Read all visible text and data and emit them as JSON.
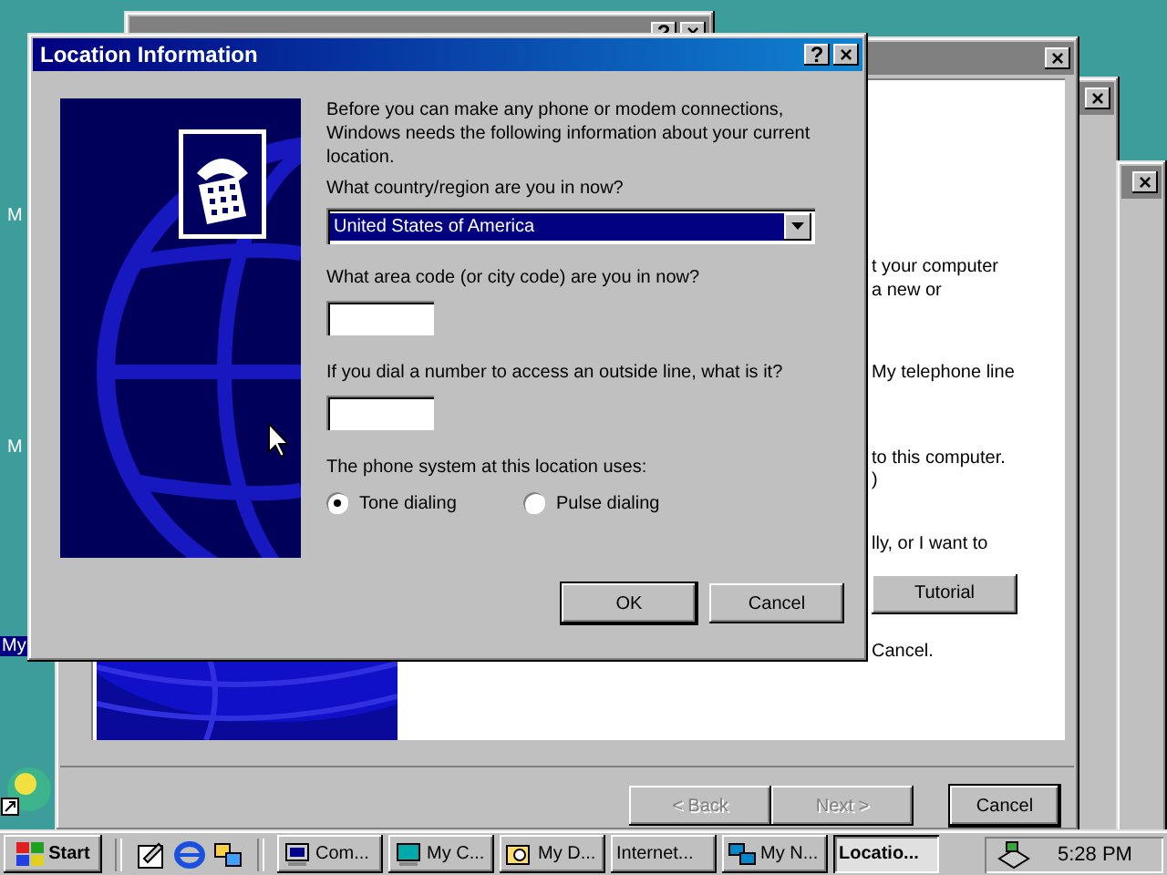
{
  "desktop": {
    "icon_labels": [
      {
        "text": "M",
        "selected": false
      },
      {
        "text": "M",
        "selected": false
      },
      {
        "text": "My",
        "selected": true
      }
    ]
  },
  "back_window": {
    "help": "?",
    "close": "×"
  },
  "wizard_window": {
    "close": "×",
    "text_fragments": [
      "t your computer",
      "a new or",
      "My telephone line",
      "to this computer.",
      ")",
      "lly, or I want to",
      "Cancel."
    ],
    "tutorial_button": "Tutorial",
    "buttons": [
      {
        "label": "< Back",
        "disabled": true
      },
      {
        "label": "Next >",
        "disabled": true
      },
      {
        "label": "Cancel",
        "disabled": false
      }
    ]
  },
  "side_windows": [
    {
      "close": "×"
    },
    {
      "close": "×"
    }
  ],
  "dialog": {
    "title": "Location Information",
    "help": "?",
    "close": "×",
    "intro": "Before you can make any phone or modem connections, Windows needs the following information about your current location.",
    "country_label": "What country/region are you in now?",
    "country_value": "United States of America",
    "area_code_label": "What area code (or city code) are you in now?",
    "outside_line_label": "If you dial a number to access an outside line, what is it?",
    "phone_system_label": "The phone system at this location uses:",
    "dialing_options": [
      {
        "label": "Tone dialing",
        "selected": true
      },
      {
        "label": "Pulse dialing",
        "selected": false
      }
    ],
    "buttons": [
      "OK",
      "Cancel"
    ]
  },
  "taskbar": {
    "start": "Start",
    "tasks": [
      {
        "label": "Com...",
        "selected": false
      },
      {
        "label": "My C...",
        "selected": false
      },
      {
        "label": "My D...",
        "selected": false
      },
      {
        "label": "Internet...",
        "selected": false
      },
      {
        "label": "My N...",
        "selected": false
      },
      {
        "label": "Locatio...",
        "selected": true
      }
    ],
    "clock": "5:28 PM"
  }
}
